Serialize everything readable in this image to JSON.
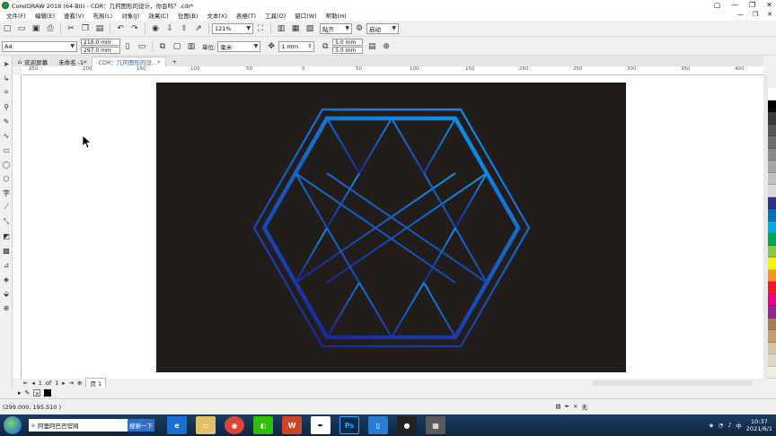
{
  "window": {
    "title": "CorelDRAW 2018 (64-Bit) - CDR：几何图形的设计，你会吗？.cdr*",
    "controls": [
      "▢",
      "—",
      "❐",
      "✕"
    ]
  },
  "menu": {
    "items": [
      "文件(F)",
      "编辑(E)",
      "查看(V)",
      "布局(L)",
      "对象(J)",
      "效果(C)",
      "位图(B)",
      "文本(X)",
      "表格(T)",
      "工具(O)",
      "窗口(W)",
      "帮助(H)"
    ],
    "right": [
      "—",
      "❐",
      "✕"
    ]
  },
  "toolbar1": {
    "zoom": "121%",
    "snap": "贴齐",
    "launch": "启动"
  },
  "toolbar2": {
    "page_size": "A4",
    "width": "210.0 mm",
    "height": "297.0 mm",
    "units_label": "单位:",
    "units": "毫米",
    "nudge": "1 mm",
    "dup_x": "5.0 mm",
    "dup_y": "5.0 mm"
  },
  "tabs": [
    {
      "label": "欢迎屏幕"
    },
    {
      "label": "未命名 -1*"
    },
    {
      "label": "CDR：几何图形的设...*"
    }
  ],
  "ruler": {
    "top": [
      "250",
      "200",
      "150",
      "100",
      "50",
      "0",
      "50",
      "100",
      "150",
      "200",
      "250",
      "300",
      "350",
      "400"
    ]
  },
  "pagenav": {
    "current": "1",
    "of": "of",
    "total": "1",
    "page_tab": "页 1"
  },
  "status": {
    "coords": "(299.000, 195.510 )",
    "fill_none": "无"
  },
  "taskbar": {
    "search_text": "阿里阿巴巴官网",
    "search_button": "搜索一下",
    "time": "10:37",
    "date": "2021/6/1"
  },
  "colors": {
    "page_bg": "#221d1a",
    "gradient_start": "#0d8fe8",
    "gradient_end": "#1b2a9c",
    "accent_tab": "#2a5db0"
  }
}
